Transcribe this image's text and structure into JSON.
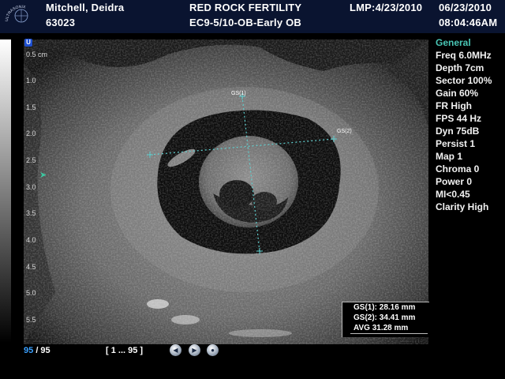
{
  "header": {
    "patient_name": "Mitchell, Deidra",
    "patient_id": "63023",
    "clinic": "RED ROCK FERTILITY",
    "exam": "EC9-5/10-OB-Early OB",
    "lmp": "LMP:4/23/2010",
    "date": "06/23/2010",
    "time": "08:04:46AM",
    "logo_text": "ULTRASONIX"
  },
  "probe": {
    "marker": "U"
  },
  "depth_scale": [
    "0.5 cm",
    "1.0",
    "1.5",
    "2.0",
    "2.5",
    "3.0",
    "3.5",
    "4.0",
    "4.5",
    "5.0",
    "5.5"
  ],
  "params": [
    "General",
    "Freq 6.0MHz",
    "Depth 7cm",
    "Sector 100%",
    "Gain 60%",
    "FR High",
    "FPS 44 Hz",
    "Dyn 75dB",
    "Persist 1",
    "Map 1",
    "Chroma 0",
    "Power 0",
    "MI<0.45",
    "Clarity High"
  ],
  "calipers": {
    "gs1": "GS(1)",
    "gs2": "GS(2)"
  },
  "measurements": [
    "GS(1): 28.16 mm",
    "GS(2): 34.41 mm",
    "AVG 31.28 mm"
  ],
  "footer": {
    "frame_current": "95",
    "frame_total": "/ 95",
    "frame_range": "[ 1 ... 95 ]"
  },
  "colors": {
    "header_bg": "#0a1430",
    "accent_teal": "#49c6b5",
    "frame_blue": "#3aa0ff",
    "caliper": "#5fd0d0"
  }
}
